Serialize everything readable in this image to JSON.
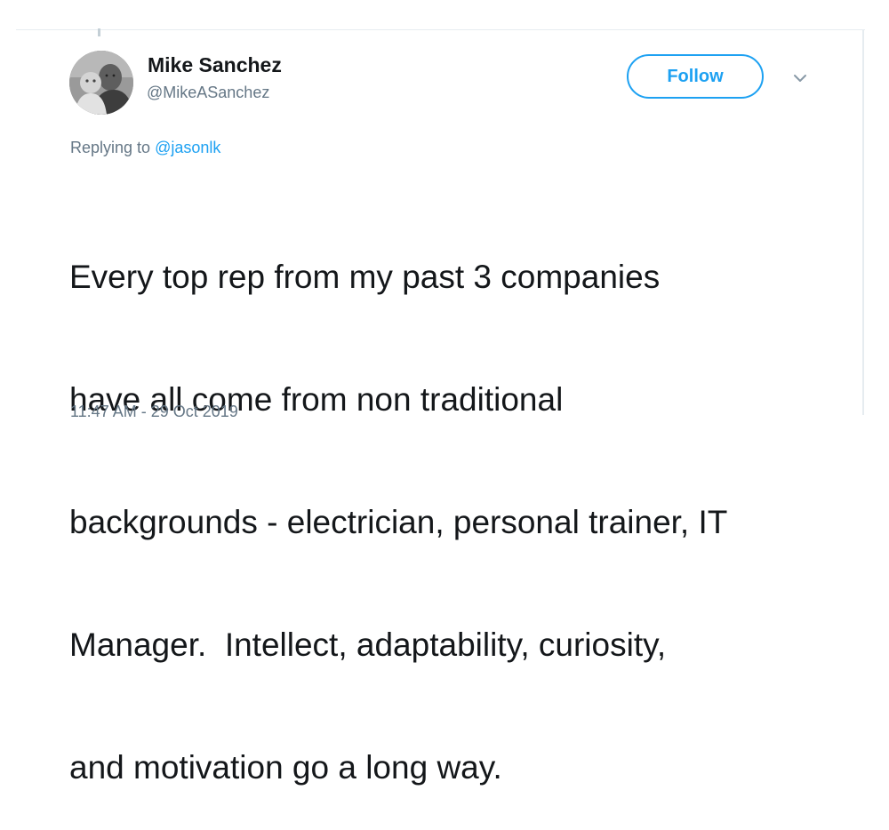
{
  "tweet": {
    "author": {
      "display_name": "Mike Sanchez",
      "handle": "@MikeASanchez",
      "avatar_icon": "profile-photo"
    },
    "follow_label": "Follow",
    "menu_icon": "chevron-down-icon",
    "reply": {
      "prefix": "Replying to ",
      "mention": "@jasonlk"
    },
    "text_lines": [
      "Every top rep from my past 3 companies",
      "have all come from non traditional",
      "backgrounds - electrician, personal trainer, IT",
      "Manager.  Intellect, adaptability, curiosity,",
      "and motivation go a long way."
    ],
    "timestamp": "11:47 AM - 29 Oct 2019"
  },
  "colors": {
    "accent": "#1da1f2",
    "text": "#14171a",
    "muted": "#657786",
    "divider": "#e6ecf0"
  }
}
